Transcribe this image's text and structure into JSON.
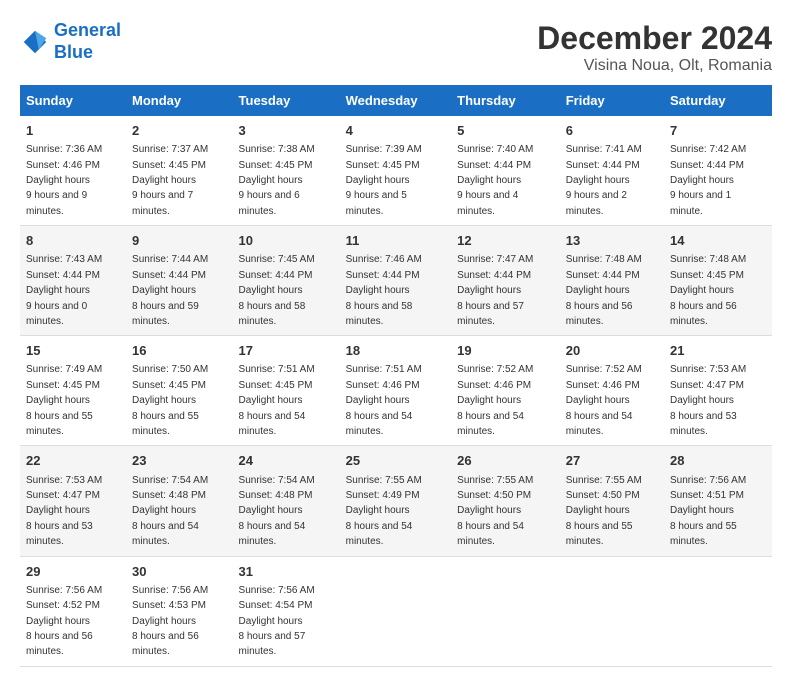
{
  "logo": {
    "text_general": "General",
    "text_blue": "Blue"
  },
  "title": "December 2024",
  "subtitle": "Visina Noua, Olt, Romania",
  "days_of_week": [
    "Sunday",
    "Monday",
    "Tuesday",
    "Wednesday",
    "Thursday",
    "Friday",
    "Saturday"
  ],
  "weeks": [
    [
      {
        "day": 1,
        "sunrise": "7:36 AM",
        "sunset": "4:46 PM",
        "daylight": "9 hours and 9 minutes."
      },
      {
        "day": 2,
        "sunrise": "7:37 AM",
        "sunset": "4:45 PM",
        "daylight": "9 hours and 7 minutes."
      },
      {
        "day": 3,
        "sunrise": "7:38 AM",
        "sunset": "4:45 PM",
        "daylight": "9 hours and 6 minutes."
      },
      {
        "day": 4,
        "sunrise": "7:39 AM",
        "sunset": "4:45 PM",
        "daylight": "9 hours and 5 minutes."
      },
      {
        "day": 5,
        "sunrise": "7:40 AM",
        "sunset": "4:44 PM",
        "daylight": "9 hours and 4 minutes."
      },
      {
        "day": 6,
        "sunrise": "7:41 AM",
        "sunset": "4:44 PM",
        "daylight": "9 hours and 2 minutes."
      },
      {
        "day": 7,
        "sunrise": "7:42 AM",
        "sunset": "4:44 PM",
        "daylight": "9 hours and 1 minute."
      }
    ],
    [
      {
        "day": 8,
        "sunrise": "7:43 AM",
        "sunset": "4:44 PM",
        "daylight": "9 hours and 0 minutes."
      },
      {
        "day": 9,
        "sunrise": "7:44 AM",
        "sunset": "4:44 PM",
        "daylight": "8 hours and 59 minutes."
      },
      {
        "day": 10,
        "sunrise": "7:45 AM",
        "sunset": "4:44 PM",
        "daylight": "8 hours and 58 minutes."
      },
      {
        "day": 11,
        "sunrise": "7:46 AM",
        "sunset": "4:44 PM",
        "daylight": "8 hours and 58 minutes."
      },
      {
        "day": 12,
        "sunrise": "7:47 AM",
        "sunset": "4:44 PM",
        "daylight": "8 hours and 57 minutes."
      },
      {
        "day": 13,
        "sunrise": "7:48 AM",
        "sunset": "4:44 PM",
        "daylight": "8 hours and 56 minutes."
      },
      {
        "day": 14,
        "sunrise": "7:48 AM",
        "sunset": "4:45 PM",
        "daylight": "8 hours and 56 minutes."
      }
    ],
    [
      {
        "day": 15,
        "sunrise": "7:49 AM",
        "sunset": "4:45 PM",
        "daylight": "8 hours and 55 minutes."
      },
      {
        "day": 16,
        "sunrise": "7:50 AM",
        "sunset": "4:45 PM",
        "daylight": "8 hours and 55 minutes."
      },
      {
        "day": 17,
        "sunrise": "7:51 AM",
        "sunset": "4:45 PM",
        "daylight": "8 hours and 54 minutes."
      },
      {
        "day": 18,
        "sunrise": "7:51 AM",
        "sunset": "4:46 PM",
        "daylight": "8 hours and 54 minutes."
      },
      {
        "day": 19,
        "sunrise": "7:52 AM",
        "sunset": "4:46 PM",
        "daylight": "8 hours and 54 minutes."
      },
      {
        "day": 20,
        "sunrise": "7:52 AM",
        "sunset": "4:46 PM",
        "daylight": "8 hours and 54 minutes."
      },
      {
        "day": 21,
        "sunrise": "7:53 AM",
        "sunset": "4:47 PM",
        "daylight": "8 hours and 53 minutes."
      }
    ],
    [
      {
        "day": 22,
        "sunrise": "7:53 AM",
        "sunset": "4:47 PM",
        "daylight": "8 hours and 53 minutes."
      },
      {
        "day": 23,
        "sunrise": "7:54 AM",
        "sunset": "4:48 PM",
        "daylight": "8 hours and 54 minutes."
      },
      {
        "day": 24,
        "sunrise": "7:54 AM",
        "sunset": "4:48 PM",
        "daylight": "8 hours and 54 minutes."
      },
      {
        "day": 25,
        "sunrise": "7:55 AM",
        "sunset": "4:49 PM",
        "daylight": "8 hours and 54 minutes."
      },
      {
        "day": 26,
        "sunrise": "7:55 AM",
        "sunset": "4:50 PM",
        "daylight": "8 hours and 54 minutes."
      },
      {
        "day": 27,
        "sunrise": "7:55 AM",
        "sunset": "4:50 PM",
        "daylight": "8 hours and 55 minutes."
      },
      {
        "day": 28,
        "sunrise": "7:56 AM",
        "sunset": "4:51 PM",
        "daylight": "8 hours and 55 minutes."
      }
    ],
    [
      {
        "day": 29,
        "sunrise": "7:56 AM",
        "sunset": "4:52 PM",
        "daylight": "8 hours and 56 minutes."
      },
      {
        "day": 30,
        "sunrise": "7:56 AM",
        "sunset": "4:53 PM",
        "daylight": "8 hours and 56 minutes."
      },
      {
        "day": 31,
        "sunrise": "7:56 AM",
        "sunset": "4:54 PM",
        "daylight": "8 hours and 57 minutes."
      },
      null,
      null,
      null,
      null
    ]
  ]
}
